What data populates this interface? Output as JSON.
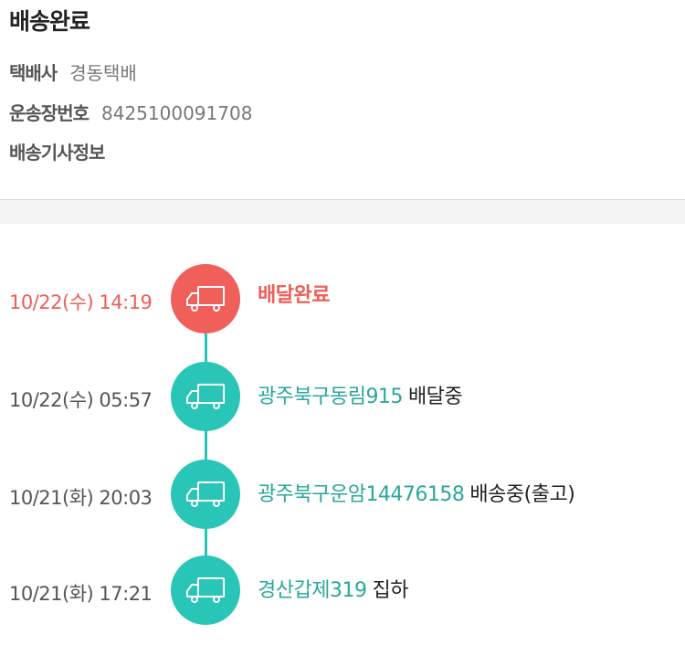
{
  "header": {
    "status_title": "배송완료",
    "courier_label": "택배사",
    "courier_value": "경동택배",
    "tracking_label": "운송장번호",
    "tracking_value": "8425100091708",
    "driver_label": "배송기사정보"
  },
  "timeline": {
    "events": [
      {
        "time": "10/22(수) 14:19",
        "location": "",
        "status": "배달완료",
        "icon": "truck-icon",
        "current": true
      },
      {
        "time": "10/22(수) 05:57",
        "location": "광주북구동림915",
        "status": "배달중",
        "icon": "truck-icon",
        "current": false
      },
      {
        "time": "10/21(화) 20:03",
        "location": "광주북구운암14476158",
        "status": "배송중(출고)",
        "icon": "truck-icon",
        "current": false
      },
      {
        "time": "10/21(화) 17:21",
        "location": "경산갑제319",
        "status": "집하",
        "icon": "truck-icon",
        "current": false
      }
    ]
  },
  "colors": {
    "accent_teal": "#29c5b6",
    "location_text": "#2aa79b",
    "current_red": "#f15f5a"
  }
}
